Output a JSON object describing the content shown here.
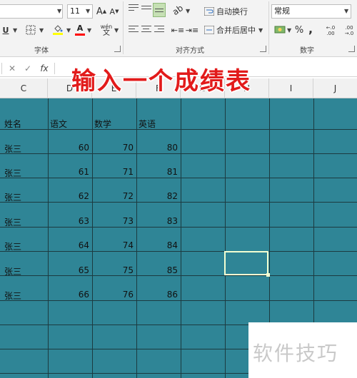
{
  "ribbon": {
    "font": {
      "size": "11",
      "grow": "A",
      "shrink": "A",
      "underline": "U",
      "fill_color": "#ffff00",
      "font_color": "#ff0000",
      "phonetic_top": "wén",
      "phonetic_bottom": "文",
      "group_label": "字体"
    },
    "alignment": {
      "wrap_text": "自动换行",
      "merge_center": "合并后居中",
      "group_label": "对齐方式"
    },
    "number": {
      "format": "常规",
      "percent": "%",
      "comma": ",",
      "inc_decimal": "←.0 .00",
      "dec_decimal": ".00 →.0",
      "group_label": "数字"
    }
  },
  "formula_bar": {
    "cancel": "✕",
    "enter": "✓",
    "fx": "fx"
  },
  "overlay_title": "输入一个成绩表",
  "columns": [
    "C",
    "D",
    "E",
    "F",
    "G",
    "H",
    "I",
    "J"
  ],
  "table": {
    "headers": [
      "姓名",
      "语文",
      "数学",
      "英语"
    ],
    "rows": [
      [
        "张三",
        "60",
        "70",
        "80"
      ],
      [
        "张三",
        "61",
        "71",
        "81"
      ],
      [
        "张三",
        "62",
        "72",
        "82"
      ],
      [
        "张三",
        "63",
        "73",
        "83"
      ],
      [
        "张三",
        "64",
        "74",
        "84"
      ],
      [
        "张三",
        "65",
        "75",
        "85"
      ],
      [
        "张三",
        "66",
        "76",
        "86"
      ]
    ]
  },
  "colors": {
    "grid_fill": "#2f8596",
    "title_red": "#e21b1b",
    "selection": "#f3ffd2"
  },
  "watermark": "软件技巧"
}
